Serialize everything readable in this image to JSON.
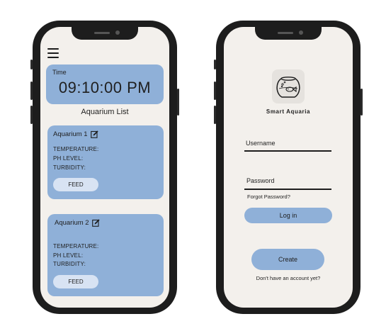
{
  "left_screen": {
    "time_label": "Time",
    "time_value": "09:10:00 PM",
    "list_title": "Aquarium List",
    "aquariums": [
      {
        "name": "Aquarium 1",
        "temperature_label": "TEMPERATURE:",
        "ph_label": "PH LEVEL:",
        "turbidity_label": "TURBIDITY:",
        "feed_label": "FEED"
      },
      {
        "name": "Aquarium 2",
        "temperature_label": "TEMPERATURE:",
        "ph_label": "PH LEVEL:",
        "turbidity_label": "TURBIDITY:",
        "feed_label": "FEED"
      }
    ],
    "colors": {
      "card": "#8fb0d8",
      "feed_button": "#d8e3f3",
      "screen_bg": "#f3f0ec"
    }
  },
  "right_screen": {
    "app_name": "Smart Aquaria",
    "username_label": "Username",
    "password_label": "Password",
    "forgot_password": "Forgot Password?",
    "login_label": "Log in",
    "create_label": "Create",
    "signup_prompt": "Don't have an account yet?",
    "icons": {
      "logo": "fishbowl-icon"
    }
  }
}
